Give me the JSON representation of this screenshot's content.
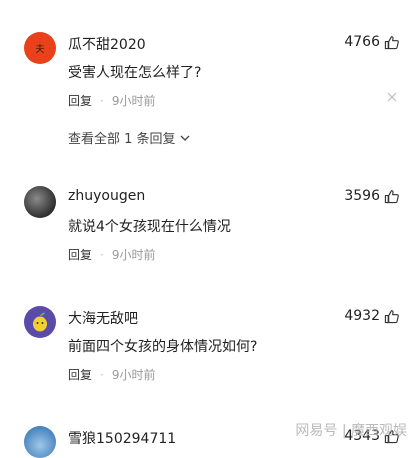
{
  "comments": [
    {
      "username": "瓜不甜2020",
      "likes": "4766",
      "text": "受害人现在怎么样了?",
      "reply_label": "回复",
      "time": "9小时前",
      "avatar_glyph": "夫",
      "expand_label": "查看全部 1 条回复"
    },
    {
      "username": "zhuyougen",
      "likes": "3596",
      "text": "就说4个女孩现在什么情况",
      "reply_label": "回复",
      "time": "9小时前"
    },
    {
      "username": "大海无敌吧",
      "likes": "4932",
      "text": "前面四个女孩的身体情况如何?",
      "reply_label": "回复",
      "time": "9小时前"
    },
    {
      "username": "雪狼150294711",
      "likes": "4343"
    }
  ],
  "watermark": "网易号 | 魔西观娱",
  "colors": {
    "accent_red": "#e8411c",
    "text": "#222222",
    "muted": "#999999"
  }
}
